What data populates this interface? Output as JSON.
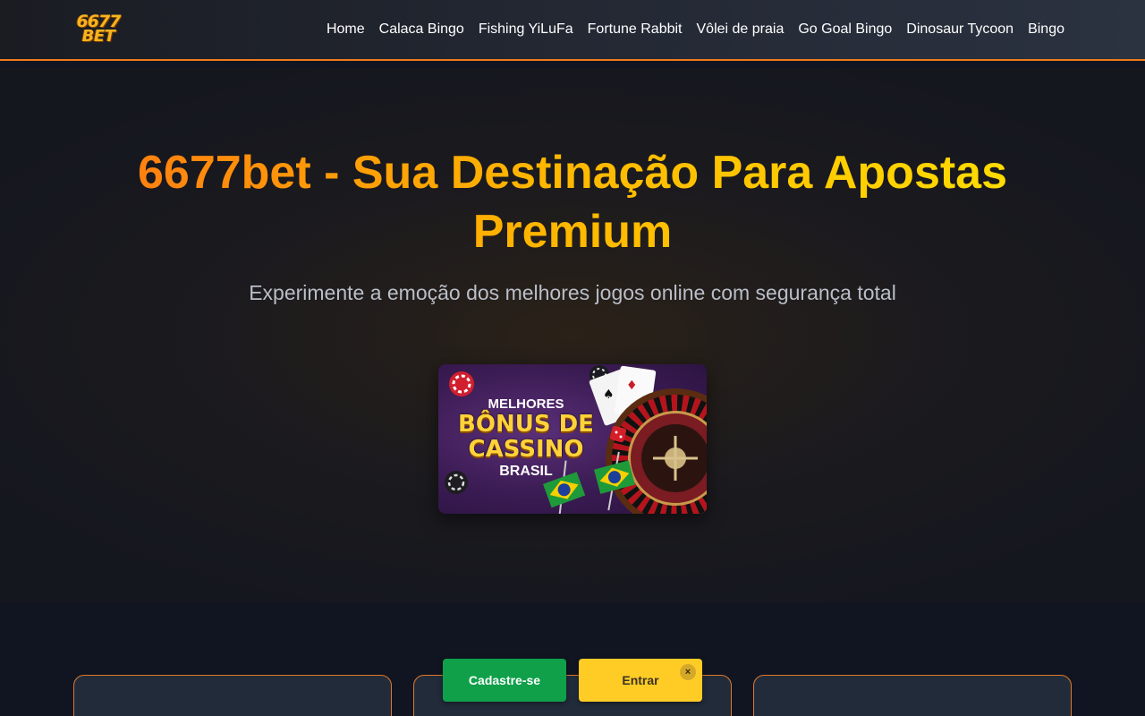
{
  "header": {
    "logo_line1": "6677",
    "logo_line2": "BET",
    "nav": [
      {
        "label": "Home"
      },
      {
        "label": "Calaca Bingo"
      },
      {
        "label": "Fishing YiLuFa"
      },
      {
        "label": "Fortune Rabbit"
      },
      {
        "label": "Vôlei de praia"
      },
      {
        "label": "Go Goal Bingo"
      },
      {
        "label": "Dinosaur Tycoon"
      },
      {
        "label": "Bingo"
      }
    ],
    "accent_color": "#f07a1a"
  },
  "hero": {
    "title": "6677bet - Sua Destinação Para Apostas Premium",
    "subtitle": "Experimente a emoção dos melhores jogos online com segurança total",
    "banner": {
      "line1": "MELHORES",
      "line2a": "BÔNUS DE",
      "line2b": "CASSINO",
      "line3": "BRASIL"
    }
  },
  "cta": {
    "register_label": "Cadastre-se",
    "login_label": "Entrar",
    "close_glyph": "×",
    "register_color": "#0fa049",
    "login_color": "#ffcc26"
  }
}
